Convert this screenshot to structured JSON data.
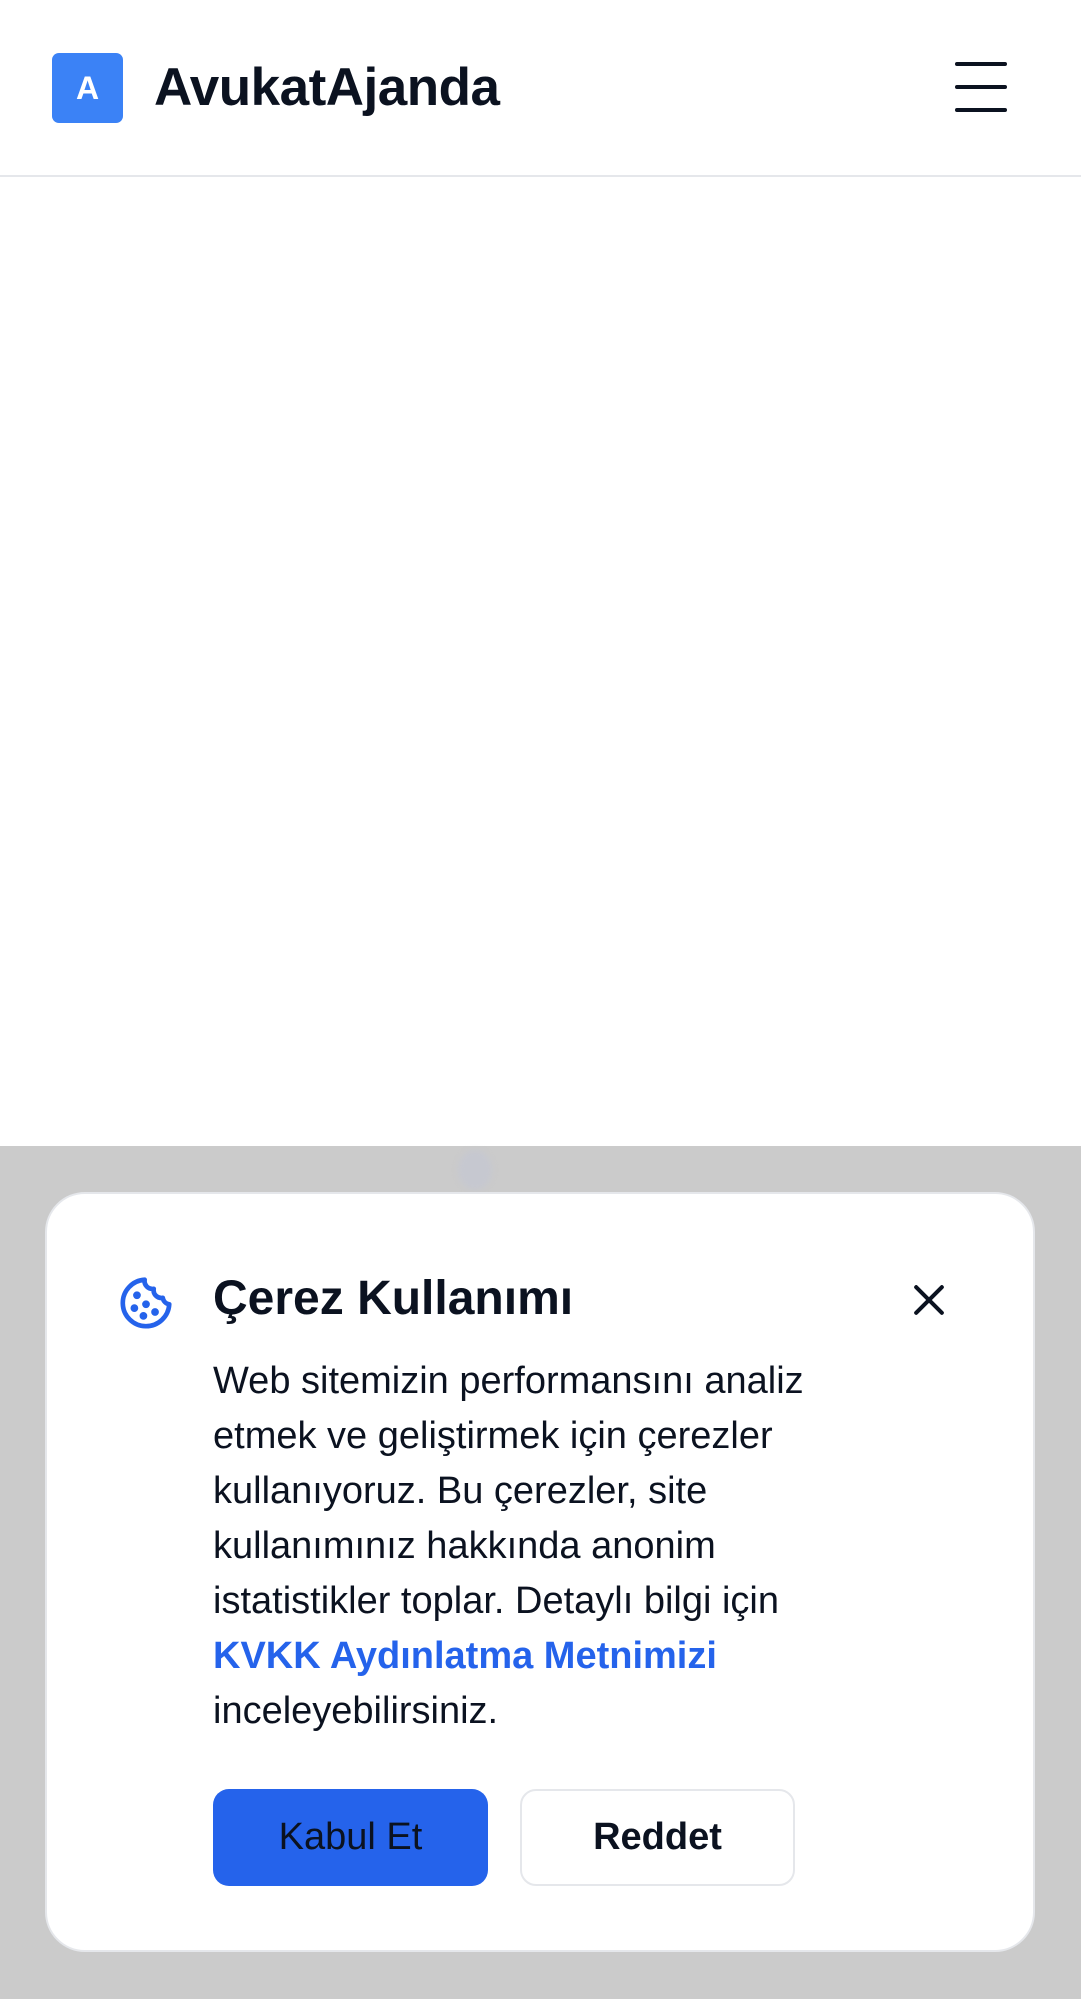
{
  "header": {
    "logo_letter": "A",
    "brand": "AvukatAjanda",
    "menu_icon": "hamburger-menu-icon"
  },
  "cookie_banner": {
    "icon": "cookie-icon",
    "title": "Çerez Kullanımı",
    "close_icon": "close-icon",
    "text_before_link": "Web sitemizin performansını analiz etmek ve geliştirmek için çerezler kullanıyoruz. Bu çerezler, site kullanımınız hakkında anonim istatistikler toplar. Detaylı bilgi için",
    "link_text": "KVKK Aydınlatma Metnimizi",
    "text_after_link": "inceleyebilirsiniz.",
    "accept_label": "Kabul Et",
    "reject_label": "Reddet"
  },
  "colors": {
    "accent": "#2563eb",
    "logo": "#3b82f6",
    "overlay": "#cbcbcb"
  }
}
